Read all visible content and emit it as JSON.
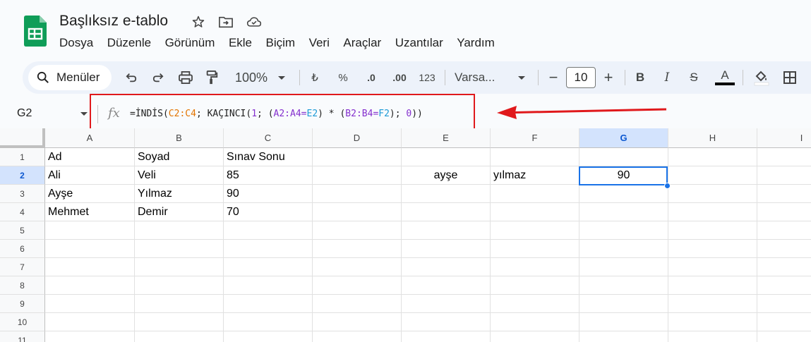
{
  "app": {
    "doc_title": "Başlıksız e-tablo",
    "menu": [
      "Dosya",
      "Düzenle",
      "Görünüm",
      "Ekle",
      "Biçim",
      "Veri",
      "Araçlar",
      "Uzantılar",
      "Yardım"
    ]
  },
  "toolbar": {
    "search_label": "Menüler",
    "zoom": "100%",
    "currency": "₺",
    "percent": "%",
    "dec_decrease": ".0",
    "dec_increase": ".00",
    "number_format": "123",
    "font": "Varsa...",
    "font_size": "10",
    "minus": "−",
    "plus": "+",
    "bold": "B",
    "italic": "I",
    "strike": "S",
    "text_color": "A"
  },
  "formula_bar": {
    "cell_ref": "G2",
    "fx": "fx",
    "parts": {
      "p1": "=İNDİS(",
      "p2": "C2:C4",
      "p3": "; KAÇINCI(",
      "p4": "1",
      "p5": "; (",
      "p6": "A2:A4",
      "p7": "=",
      "p8": "E2",
      "p9": ") * (",
      "p10": "B2:B4",
      "p11": "=",
      "p12": "F2",
      "p13": "); ",
      "p14": "0",
      "p15": "))"
    }
  },
  "grid": {
    "columns": [
      "A",
      "B",
      "C",
      "D",
      "E",
      "F",
      "G",
      "H",
      "I"
    ],
    "rows": [
      "1",
      "2",
      "3",
      "4",
      "5",
      "6",
      "7",
      "8",
      "9",
      "10",
      "11"
    ],
    "cells": {
      "A1": "Ad",
      "B1": "Soyad",
      "C1": "Sınav Sonu",
      "A2": "Ali",
      "B2": "Veli",
      "C2": "85",
      "E2": "ayşe",
      "F2": "yılmaz",
      "G2": "90",
      "A3": "Ayşe",
      "B3": "Yılmaz",
      "C3": "90",
      "A4": "Mehmet",
      "B4": "Demir",
      "C4": "70"
    }
  },
  "colors": {
    "accent": "#1a73e8",
    "highlight_annotation": "#e0191c",
    "sheets_green": "#0f9d58"
  }
}
